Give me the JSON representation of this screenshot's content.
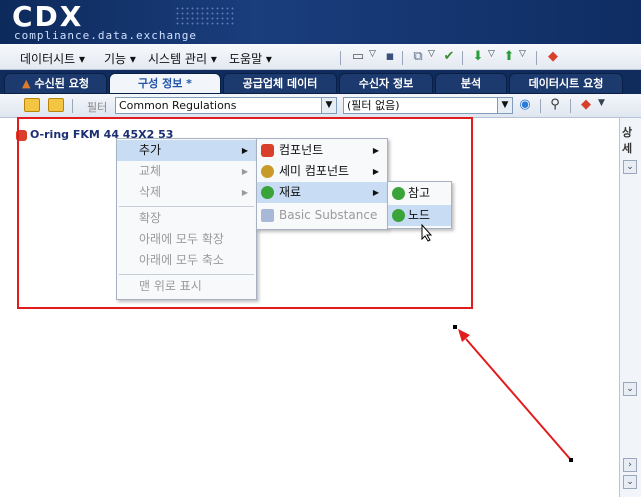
{
  "app": {
    "logo": "CDX",
    "logo_sub": "compliance.data.exchange"
  },
  "menubar": {
    "items": [
      "데이터시트 ▾",
      "기능 ▾",
      "시스템 관리 ▾",
      "도움말 ▾"
    ]
  },
  "tabs": [
    {
      "label": "수신된 요청",
      "active": false
    },
    {
      "label": "구성 정보 *",
      "active": true
    },
    {
      "label": "공급업체 데이터",
      "active": false
    },
    {
      "label": "수신자 정보",
      "active": false
    },
    {
      "label": "분석",
      "active": false
    },
    {
      "label": "데이터시트 요청",
      "active": false
    }
  ],
  "filterbar": {
    "label": "필터",
    "regulation_value": "Common Regulations",
    "filter_value": "(필터 없음)"
  },
  "tree": {
    "node_label": "O-ring FKM 44 45X2 53"
  },
  "right_pane": {
    "label": "상세"
  },
  "context_menu": {
    "items": [
      {
        "label": "추가",
        "disabled": false,
        "submenu": true,
        "hover": true
      },
      {
        "label": "교체",
        "disabled": true,
        "submenu": true
      },
      {
        "label": "삭제",
        "disabled": true,
        "submenu": true
      },
      {
        "label": "확장",
        "disabled": true
      },
      {
        "label": "아래에 모두 확장",
        "disabled": true
      },
      {
        "label": "아래에 모두 축소",
        "disabled": true
      },
      {
        "label": "맨 위로 표시",
        "disabled": true
      }
    ]
  },
  "submenu_add": {
    "items": [
      {
        "label": "컴포넌트",
        "icon": "component-icon",
        "submenu": true
      },
      {
        "label": "세미 컴포넌트",
        "icon": "semi-component-icon",
        "submenu": true
      },
      {
        "label": "재료",
        "icon": "material-icon",
        "submenu": true,
        "hover": true
      },
      {
        "label": "Basic Substance",
        "icon": "substance-icon",
        "disabled": true
      }
    ]
  },
  "submenu_material": {
    "items": [
      {
        "label": "참고",
        "icon": "reference-icon"
      },
      {
        "label": "노드",
        "icon": "node-icon",
        "hover": true
      }
    ]
  },
  "colors": {
    "header_bg": "#0f2c5c",
    "annotation_red": "#e21c1c",
    "menu_hover": "#c8dcf3"
  }
}
